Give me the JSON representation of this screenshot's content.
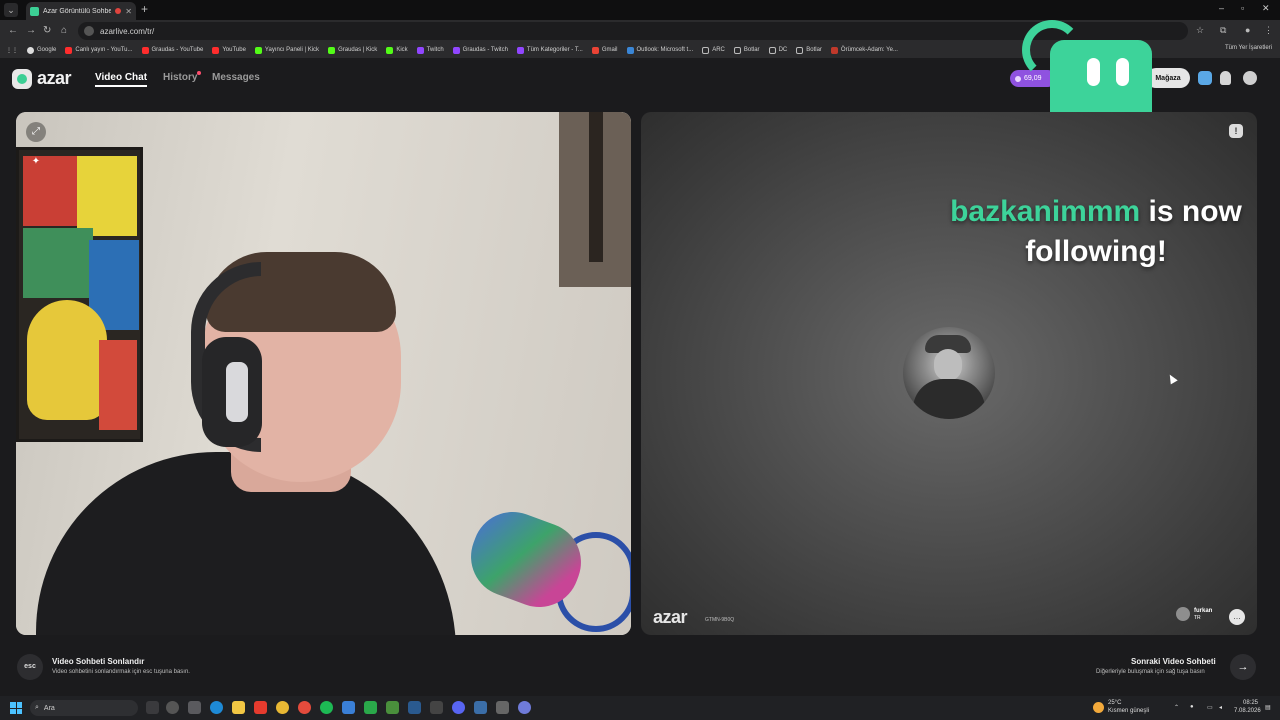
{
  "browser": {
    "tab_title": "Azar Görüntülü Sohbet & V",
    "url": "azarlive.com/tr/",
    "bookmarks": [
      "Google",
      "Canlı yayın - YouTu...",
      "Graudas - YouTube",
      "YouTube",
      "Yayıncı Paneli | Kick",
      "Graudas | Kick",
      "Kick",
      "Twitch",
      "Graudas - Twitch",
      "Tüm Kategoriler - T...",
      "Gmail",
      "Outlook: Microsoft t...",
      "ARC",
      "Botlar",
      "DC",
      "Botlar",
      "Örümcek-Adam: Ye..."
    ],
    "bookmarks_right": "Tüm Yer İşaretleri"
  },
  "app": {
    "logo_text": "azar",
    "nav": {
      "video_chat": "Video Chat",
      "history": "History",
      "messages": "Messages"
    },
    "gem_count": "69,09",
    "store_label": "Mağaza"
  },
  "overlay": {
    "follower_name": "bazkanimmm",
    "follow_suffix": " is now following!"
  },
  "remote": {
    "watermark": "azar",
    "watermark_id": "GTMN-9B0Q",
    "peer_name": "furkan",
    "peer_country": "TR"
  },
  "footer": {
    "esc_key": "esc",
    "end_title": "Video Sohbeti Sonlandır",
    "end_sub": "Video sohbetini sonlandırmak için esc tuşuna basın.",
    "next_title": "Sonraki Video Sohbeti",
    "next_sub": "Diğerleriyle buluşmak için sağ tuşa basın"
  },
  "taskbar": {
    "search_placeholder": "Ara",
    "weather_temp": "25°C",
    "weather_text": "Kısmen güneşli",
    "time": "08:25",
    "date": "7.08.2026"
  },
  "colors": {
    "accent": "#3dd39a",
    "gem": "#8f52e0"
  }
}
